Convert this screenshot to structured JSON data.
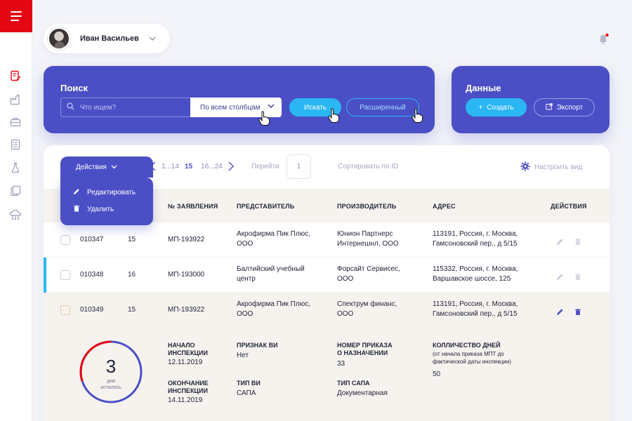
{
  "user": {
    "name": "Иван Васильев"
  },
  "search": {
    "title": "Поиск",
    "placeholder": "Что ищем?",
    "scope": "По всем столбцам",
    "search_button": "Искать",
    "advanced_button": "Расширенный"
  },
  "data_panel": {
    "title": "Данные",
    "create_button": "Создать",
    "export_button": "Экспорт"
  },
  "toolbar": {
    "actions_label": "Действия",
    "actions_menu": [
      "Редактировать",
      "Удалить"
    ],
    "pages_before": "1...14",
    "current_page": "15",
    "pages_after": "16...24",
    "goto_label": "Перейти",
    "goto_value": "1",
    "sort_label": "Сортировать по ID",
    "configure_label": "Настроить вид"
  },
  "table": {
    "columns": [
      "№ ЗАЯВЛЕНИЯ",
      "ПРЕДСТАВИТЕЛЬ",
      "ПРОИЗВОДИТЕЛЬ",
      "АДРЕС",
      "ДЕЙСТВИЯ"
    ],
    "rows": [
      {
        "id": "010347",
        "num": "15",
        "app": "МП-193922",
        "rep": [
          "Акрофирма Пик Плюс,",
          "ООО"
        ],
        "maker": [
          "Юнион Партнерс",
          "Интернешнл, ООО"
        ],
        "addr": [
          "113191, Россия, г. Москва,",
          "Гамсоновский пер., д 5/15"
        ]
      },
      {
        "id": "010348",
        "num": "16",
        "app": "МП-193000",
        "rep": [
          "Балтийский учебный",
          "центр"
        ],
        "maker": [
          "Форсайт Сервисес,",
          "ООО"
        ],
        "addr": [
          "115332, Россия, г. Москва,",
          "Варшавское шоссе, 125"
        ]
      },
      {
        "id": "010349",
        "num": "15",
        "app": "МП-193922",
        "rep": [
          "Акрофирма Пик Плюс,",
          "ООО"
        ],
        "maker": [
          "Спектрум финанс,",
          "ООО"
        ],
        "addr": [
          "113191, Россия, г. Москва,",
          "Гамсоновский пер., д 5/15"
        ]
      }
    ]
  },
  "details": {
    "days_left": "3",
    "days_caption": [
      "дня",
      "осталось"
    ],
    "days_progress": 0.7,
    "start_label": [
      "НАЧАЛО",
      "ИНСПЕКЦИИ"
    ],
    "start_value": "12.11.2019",
    "end_label": [
      "ОКОНЧАНИЕ",
      "ИНСПЕКЦИИ"
    ],
    "end_value": "14.11.2019",
    "sign_label": "ПРИЗНАК ВИ",
    "sign_value": "Нет",
    "type_label": "ТИП ВИ",
    "type_value": "САПА",
    "order_label": [
      "НОМЕР ПРИКАЗА",
      "О НАЗНАЧЕНИИ"
    ],
    "order_value": "33",
    "sapa_label": "ТИП САПА",
    "sapa_value": "Документарная",
    "days_count_label": "КОЛЛИЧЕСТВО ДНЕЙ",
    "days_count_note": [
      "(от начала приказа МПТ до",
      "фактической даты инспекции)"
    ],
    "days_count_value": "50"
  },
  "colors": {
    "brand": "#4b4fc6",
    "accent": "#2ab6f2",
    "menu_red": "#e30613",
    "ring_warning": "#e30613"
  },
  "icons": [
    "menu-icon",
    "document-edit-icon",
    "factory-icon",
    "briefcase-icon",
    "checklist-icon",
    "flask-icon",
    "copy-icon",
    "cloud-network-icon",
    "bell-icon",
    "search-icon",
    "chevron-down-icon",
    "plus-icon",
    "export-icon",
    "pencil-icon",
    "trash-icon",
    "gear-icon"
  ]
}
